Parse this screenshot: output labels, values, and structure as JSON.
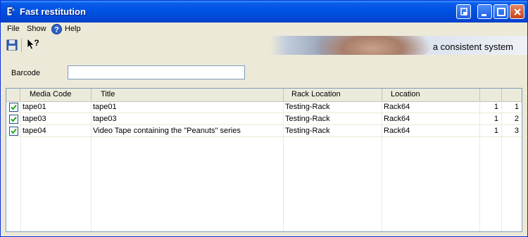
{
  "window": {
    "title": "Fast restitution"
  },
  "menu": {
    "items": [
      "File",
      "Show",
      "Help"
    ]
  },
  "toolbar": {
    "save_icon": "save-icon",
    "help_pointer_icon": "whats-this-icon"
  },
  "banner": {
    "text": "a consistent system"
  },
  "barcode": {
    "label": "Barcode",
    "value": ""
  },
  "table": {
    "columns": [
      "",
      "Media Code",
      "Title",
      "Rack Location",
      "Location",
      "",
      ""
    ],
    "rows": [
      {
        "checked": true,
        "media_code": "tape01",
        "title": "tape01",
        "rack_location": "Testing-Rack",
        "location": "Rack64",
        "n1": "1",
        "n2": "1"
      },
      {
        "checked": true,
        "media_code": "tape03",
        "title": "tape03",
        "rack_location": "Testing-Rack",
        "location": "Rack64",
        "n1": "1",
        "n2": "2"
      },
      {
        "checked": true,
        "media_code": "tape04",
        "title": "Video Tape containing the \"Peanuts\" series",
        "rack_location": "Testing-Rack",
        "location": "Rack64",
        "n1": "1",
        "n2": "3"
      }
    ]
  },
  "colors": {
    "titlebar": "#0054e3",
    "checkbox_border": "#1c5180",
    "checkmark": "#21a121"
  }
}
